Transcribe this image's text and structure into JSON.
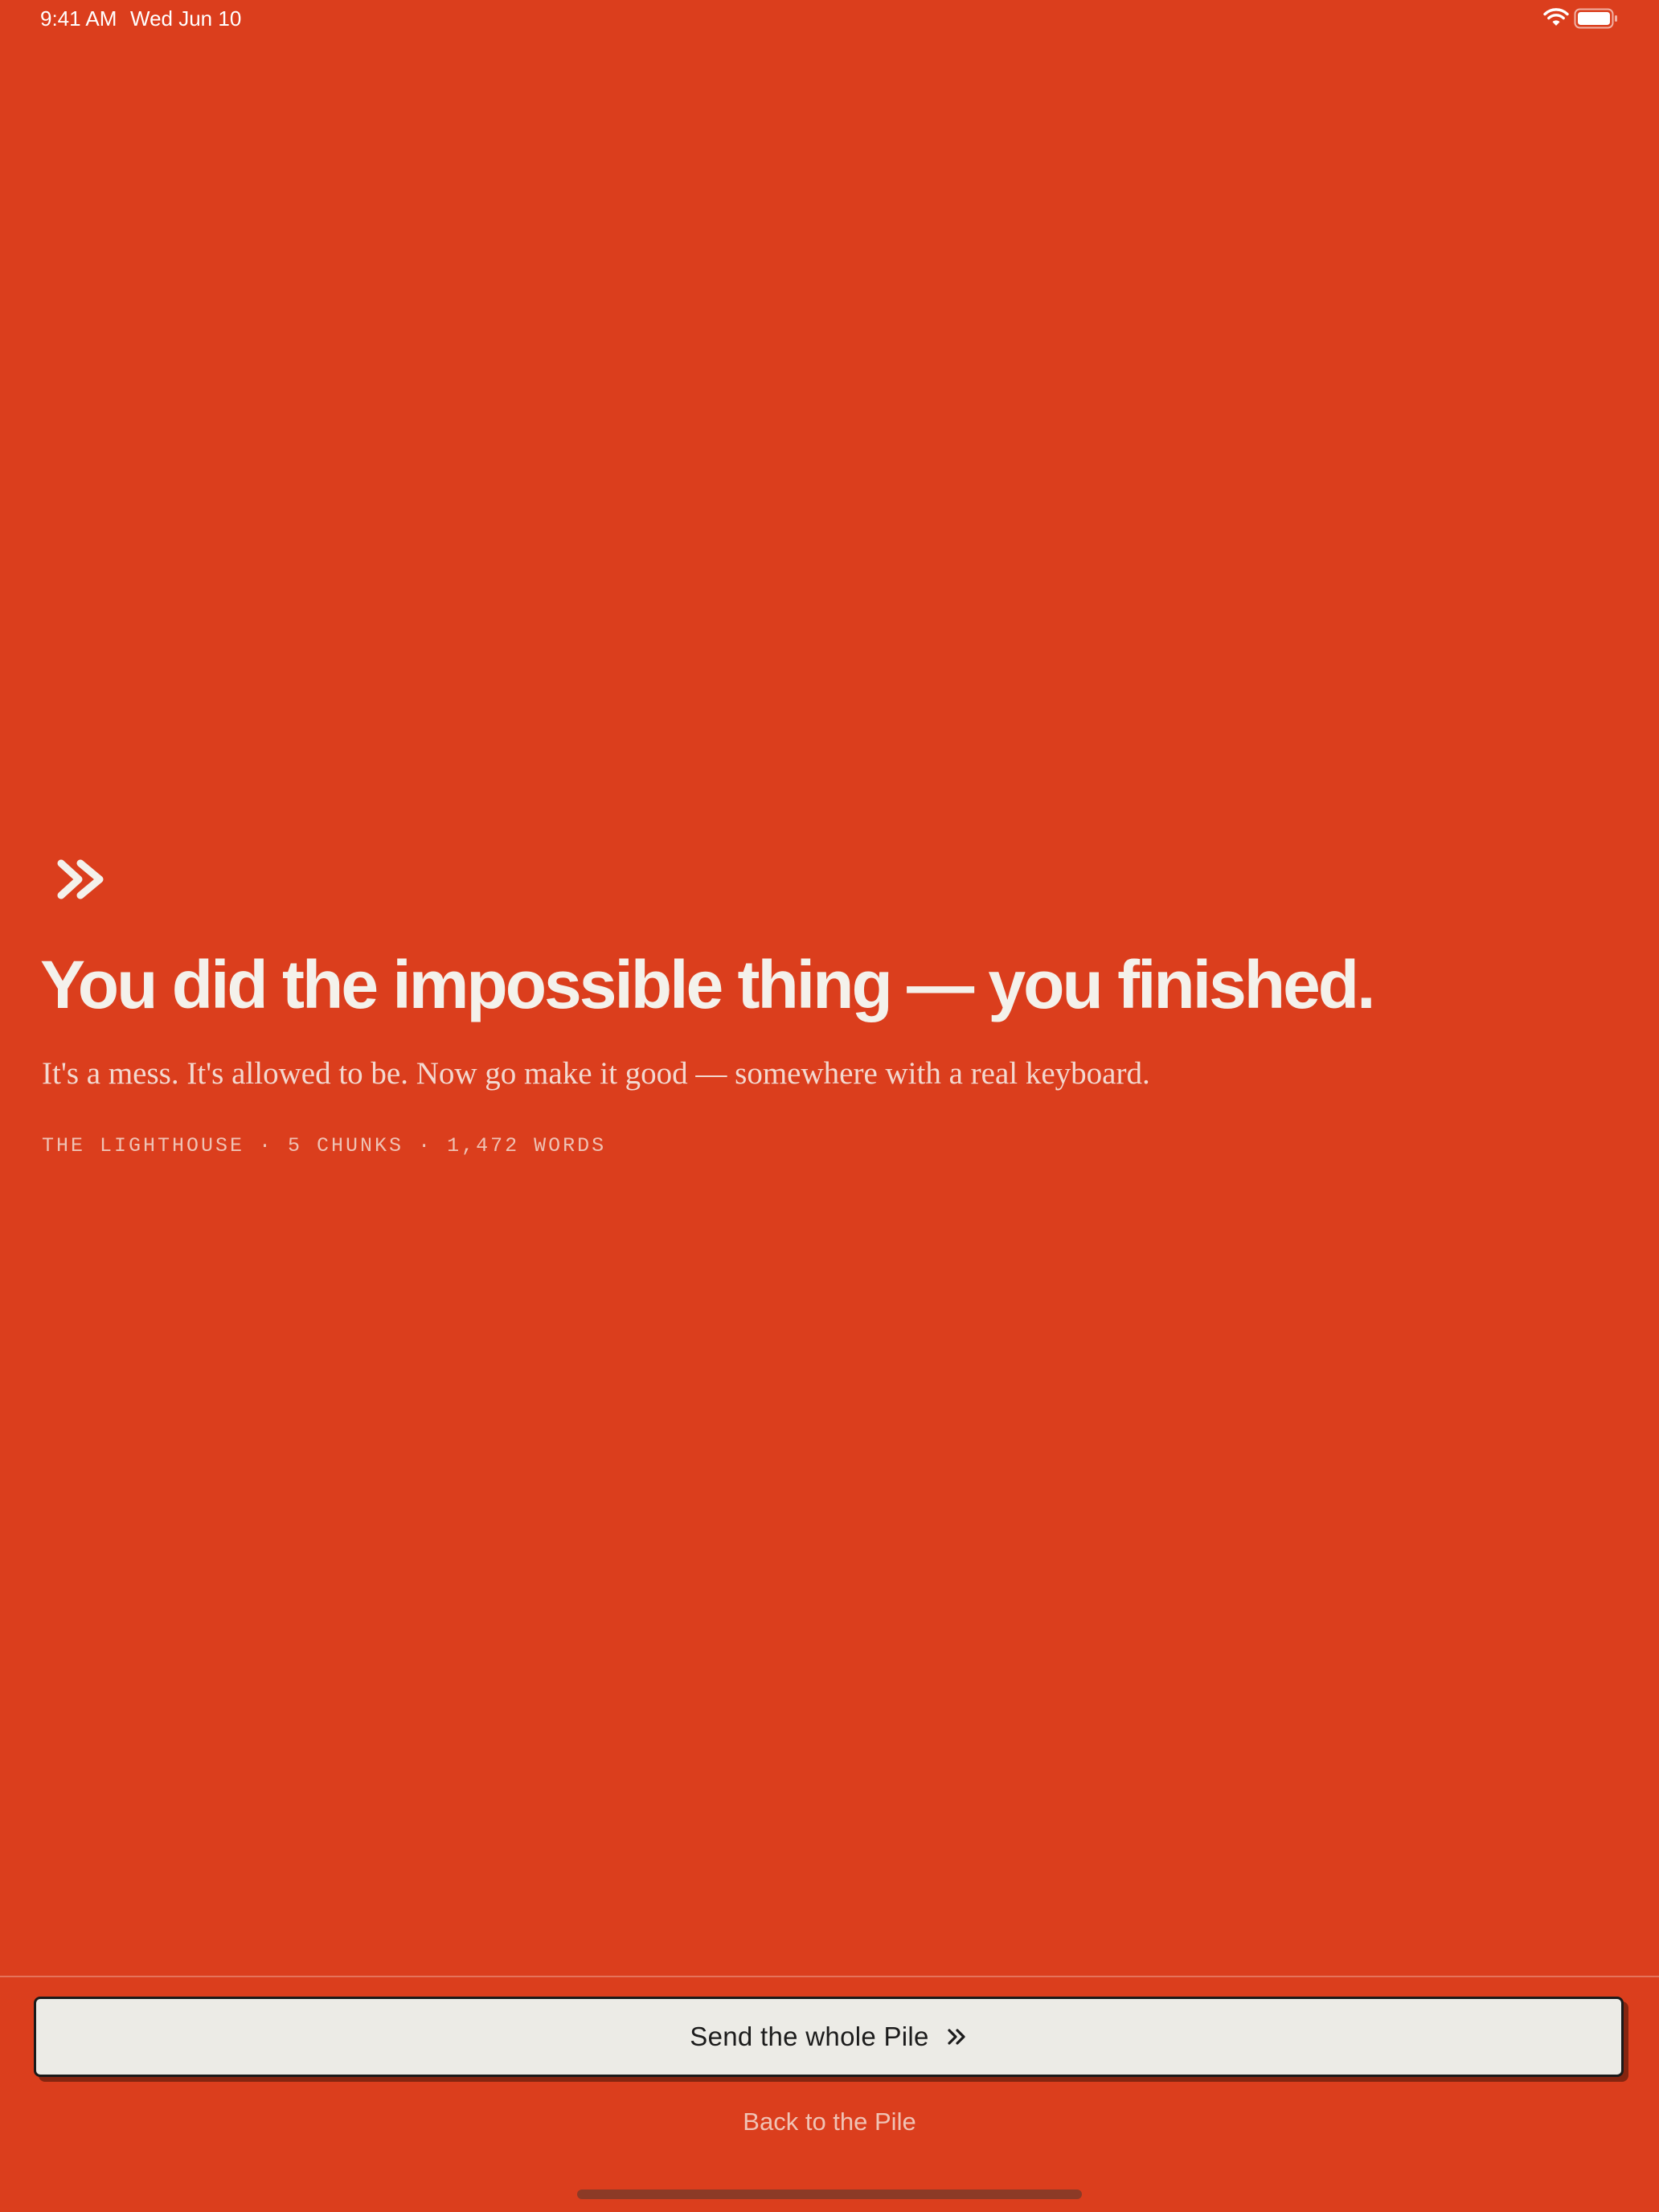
{
  "status_bar": {
    "time": "9:41 AM",
    "date": "Wed Jun 10",
    "icons": [
      "wifi-icon",
      "battery-icon"
    ]
  },
  "main": {
    "icon": "double-chevron-right-icon",
    "headline": "You did the impossible thing — you finished.",
    "subhead": "It's a mess. It's allowed to be. Now go make it good — somewhere with a real keyboard.",
    "meta": "THE LIGHTHOUSE · 5 CHUNKS · 1,472 WORDS"
  },
  "footer": {
    "send_button_label": "Send the whole Pile",
    "send_button_icon": "double-chevron-right-icon",
    "back_link_label": "Back to the Pile"
  },
  "colors": {
    "background": "#DB3E1D",
    "text_primary": "#F4F1EB",
    "button_background": "#ECEBE6",
    "button_text": "#1C1C1C"
  }
}
